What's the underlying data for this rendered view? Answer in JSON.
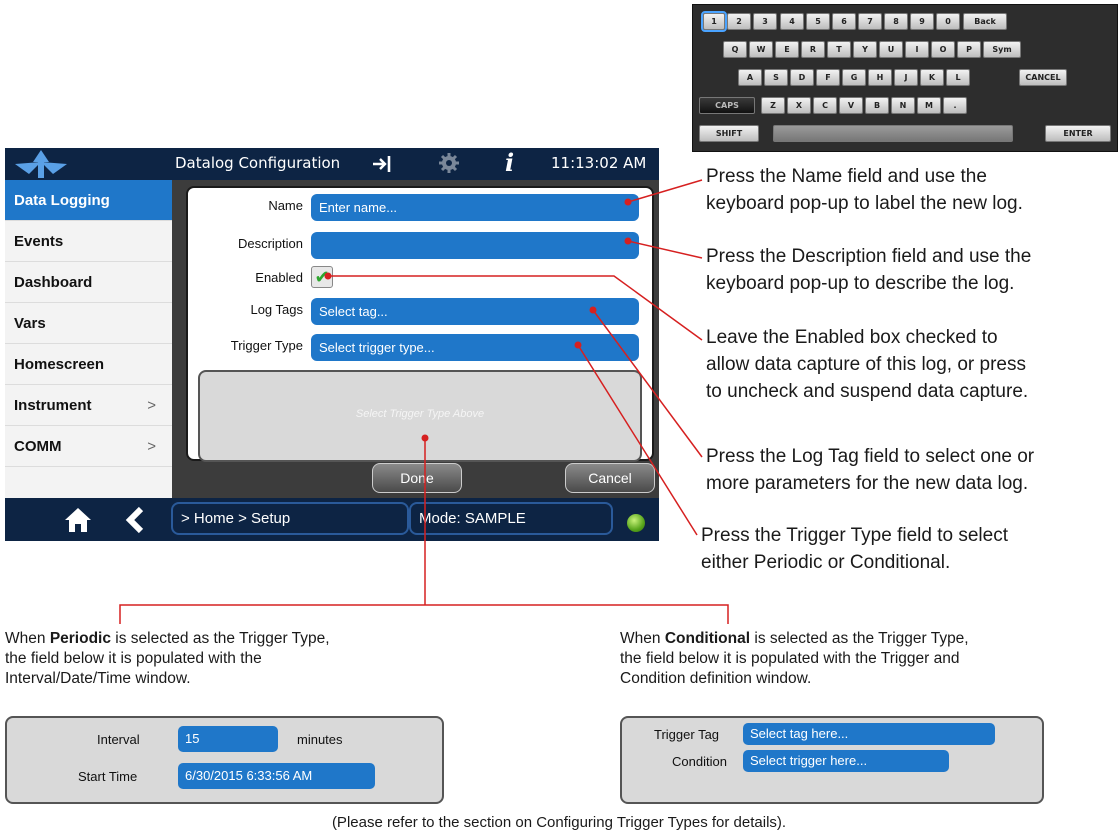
{
  "keyboard": {
    "rows": [
      [
        "1",
        "2",
        "3",
        "4",
        "5",
        "6",
        "7",
        "8",
        "9",
        "0",
        "Back"
      ],
      [
        "Q",
        "W",
        "E",
        "R",
        "T",
        "Y",
        "U",
        "I",
        "O",
        "P",
        "Sym"
      ],
      [
        "A",
        "S",
        "D",
        "F",
        "G",
        "H",
        "J",
        "K",
        "L",
        "CANCEL"
      ],
      [
        "CAPS",
        "Z",
        "X",
        "C",
        "V",
        "B",
        "N",
        "M",
        "."
      ],
      [
        "SHIFT",
        "",
        "ENTER"
      ]
    ]
  },
  "screen": {
    "title": "Datalog Configuration",
    "clock": "11:13:02 AM",
    "icons": {
      "export": "export-icon",
      "settings": "gear-icon",
      "info": "info-icon",
      "home": "home-icon",
      "back": "back-chevron-icon"
    },
    "sidebar": {
      "items": [
        {
          "label": "Data Logging",
          "active": true,
          "chevron": ""
        },
        {
          "label": "Events",
          "active": false,
          "chevron": ""
        },
        {
          "label": "Dashboard",
          "active": false,
          "chevron": ""
        },
        {
          "label": "Vars",
          "active": false,
          "chevron": ""
        },
        {
          "label": "Homescreen",
          "active": false,
          "chevron": ""
        },
        {
          "label": "Instrument",
          "active": false,
          "chevron": ">"
        },
        {
          "label": "COMM",
          "active": false,
          "chevron": ">"
        }
      ]
    },
    "form": {
      "name_label": "Name",
      "name_placeholder": "Enter name...",
      "description_label": "Description",
      "description_value": "",
      "enabled_label": "Enabled",
      "enabled_checked": true,
      "log_tags_label": "Log Tags",
      "log_tags_value": "Select tag...",
      "trigger_type_label": "Trigger Type",
      "trigger_type_value": "Select trigger type...",
      "trigger_hint": "Select Trigger Type Above"
    },
    "buttons": {
      "done": "Done",
      "cancel": "Cancel"
    },
    "breadcrumb": "> Home > Setup",
    "mode": "Mode: SAMPLE",
    "colors": {
      "accent": "#1f77c9",
      "bar": "#0d2444",
      "status_led": "#58a51c"
    }
  },
  "annotations": {
    "name_note": [
      "Press the Name field and use the",
      "keyboard pop-up to label the new log."
    ],
    "description_note": [
      "Press the Description field and use the",
      "keyboard pop-up to describe the log."
    ],
    "enabled_note": [
      "Leave the Enabled box checked to",
      "allow data capture of this log, or press",
      "to uncheck and suspend data capture."
    ],
    "logtag_note": [
      "Press the Log Tag field to select one or",
      "more parameters for the new data log."
    ],
    "trigger_note": [
      "Press the Trigger Type field to select",
      "either Periodic or Conditional."
    ]
  },
  "periodic": {
    "text_before": "When ",
    "keyword": "Periodic",
    "text_after": " is selected as the Trigger Type,",
    "line2": "the field below it is populated with the",
    "line3": "Interval/Date/Time window.",
    "interval_label": "Interval",
    "interval_value": "15",
    "interval_unit": "minutes",
    "start_label": "Start Time",
    "start_value": "6/30/2015 6:33:56 AM"
  },
  "conditional": {
    "text_before": "When ",
    "keyword": "Conditional",
    "text_after": " is selected as the Trigger Type,",
    "line2": "the field below it is populated with the Trigger and",
    "line3": "Condition definition window.",
    "trigger_tag_label": "Trigger Tag",
    "trigger_tag_value": "Select tag here...",
    "condition_label": "Condition",
    "condition_value": "Select trigger here..."
  },
  "footer": "(Please refer to the section on Configuring Trigger Types for details)."
}
